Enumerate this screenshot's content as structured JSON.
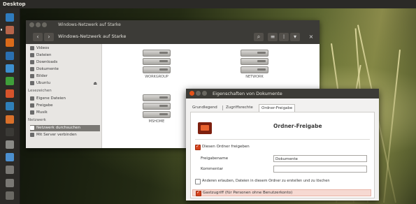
{
  "top_panel": {
    "title": "Desktop"
  },
  "launcher": {
    "items": [
      {
        "name": "dash",
        "color": "#2f7bbd"
      },
      {
        "name": "files",
        "color": "#b7654a"
      },
      {
        "name": "firefox",
        "color": "#d96a1a"
      },
      {
        "name": "thunderbird",
        "color": "#2a6fb0"
      },
      {
        "name": "writer",
        "color": "#3d8fcf"
      },
      {
        "name": "calc",
        "color": "#3f9e3a"
      },
      {
        "name": "impress",
        "color": "#d6532b"
      },
      {
        "name": "photos",
        "color": "#2f7fb8"
      },
      {
        "name": "software-center",
        "color": "#d9702a"
      },
      {
        "name": "terminal",
        "color": "#3b3a36"
      },
      {
        "name": "settings",
        "color": "#8a8a86"
      },
      {
        "name": "update",
        "color": "#4c8fcf"
      },
      {
        "name": "drive-1",
        "color": "#7a7874"
      },
      {
        "name": "drive-2",
        "color": "#7a7874"
      },
      {
        "name": "trash",
        "color": "#6a6863"
      }
    ]
  },
  "file_manager": {
    "title": "Windows-Netzwerk auf Starke",
    "path": "Windows-Netzwerk auf Starke",
    "sidebar": {
      "items": [
        {
          "label": "Videos",
          "icon": "video-icon"
        },
        {
          "label": "Dateien",
          "icon": "file-icon"
        },
        {
          "label": "Downloads",
          "icon": "download-icon"
        },
        {
          "label": "Dokumente",
          "icon": "document-icon"
        },
        {
          "label": "Bilder",
          "icon": "picture-icon"
        },
        {
          "label": "Ubuntu",
          "icon": "disk-icon"
        }
      ],
      "devices_header": "Lesezeichen",
      "bookmarks": [
        {
          "label": "Eigene Dateien",
          "icon": "folder-icon"
        },
        {
          "label": "Freigabe",
          "icon": "folder-icon"
        },
        {
          "label": "Musik",
          "icon": "folder-icon"
        }
      ],
      "network_header": "Netzwerk",
      "network": [
        {
          "label": "Netzwerk durchsuchen",
          "icon": "network-icon",
          "selected": true
        },
        {
          "label": "Mit Server verbinden",
          "icon": "server-icon",
          "selected": false
        }
      ]
    },
    "servers": [
      {
        "label": "WORKGROUP"
      },
      {
        "label": "NETWORK"
      },
      {
        "label": "MSHOME"
      }
    ]
  },
  "dialog": {
    "title": "Eigenschaften von Dokumente",
    "tabs": [
      "Grundlegend",
      "Zugriffsrechte",
      "Ordner-Freigabe"
    ],
    "heading": "Ordner-Freigabe",
    "share_checkbox": "Diesen Ordner freigeben",
    "share_name_label": "Freigabename",
    "share_name_value": "Dokumente",
    "comment_label": "Kommentar",
    "comment_value": "",
    "allow_write": "Anderen erlauben, Dateien in diesem Ordner zu erstellen und zu löschen",
    "guest_access": "Gastzugriff (für Personen ohne Benutzerkonto)"
  }
}
